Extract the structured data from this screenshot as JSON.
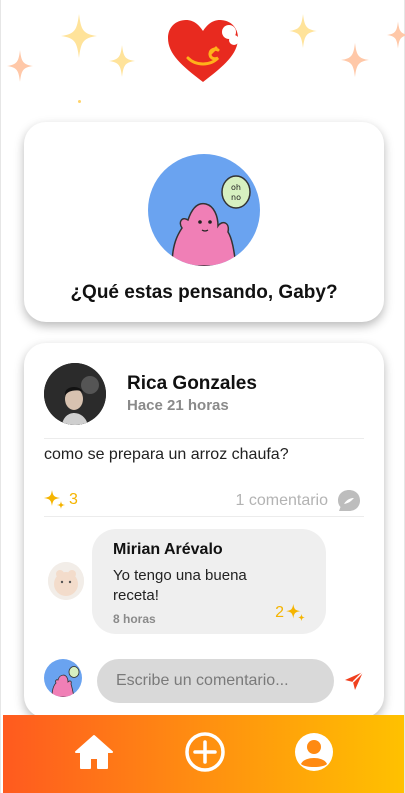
{
  "header": {
    "logo_icon": "heart-bite-icon",
    "accent_colors": {
      "heart": "#e82a1f",
      "sparkle_yellow": "#ffe18a",
      "sparkle_peach": "#ffc3a0"
    }
  },
  "prompt": {
    "question": "¿Qué estas pensando, Gaby?",
    "avatar_bubble_text": "oh no"
  },
  "post": {
    "author_name": "Rica Gonzales",
    "time": "Hace 21 horas",
    "text": "como se prepara un arroz chaufa?",
    "reaction_count": "3",
    "comment_count_label": "1 comentario",
    "comments": [
      {
        "author": "Mirian Arévalo",
        "text": "Yo tengo una buena receta!",
        "time": "8 horas",
        "reaction_count": "2"
      }
    ],
    "input_placeholder": "Escribe un comentario..."
  },
  "nav": {
    "items": [
      "home-icon",
      "add-circle-icon",
      "profile-icon"
    ],
    "gradient": [
      "#ff5a1f",
      "#ffc100"
    ]
  }
}
